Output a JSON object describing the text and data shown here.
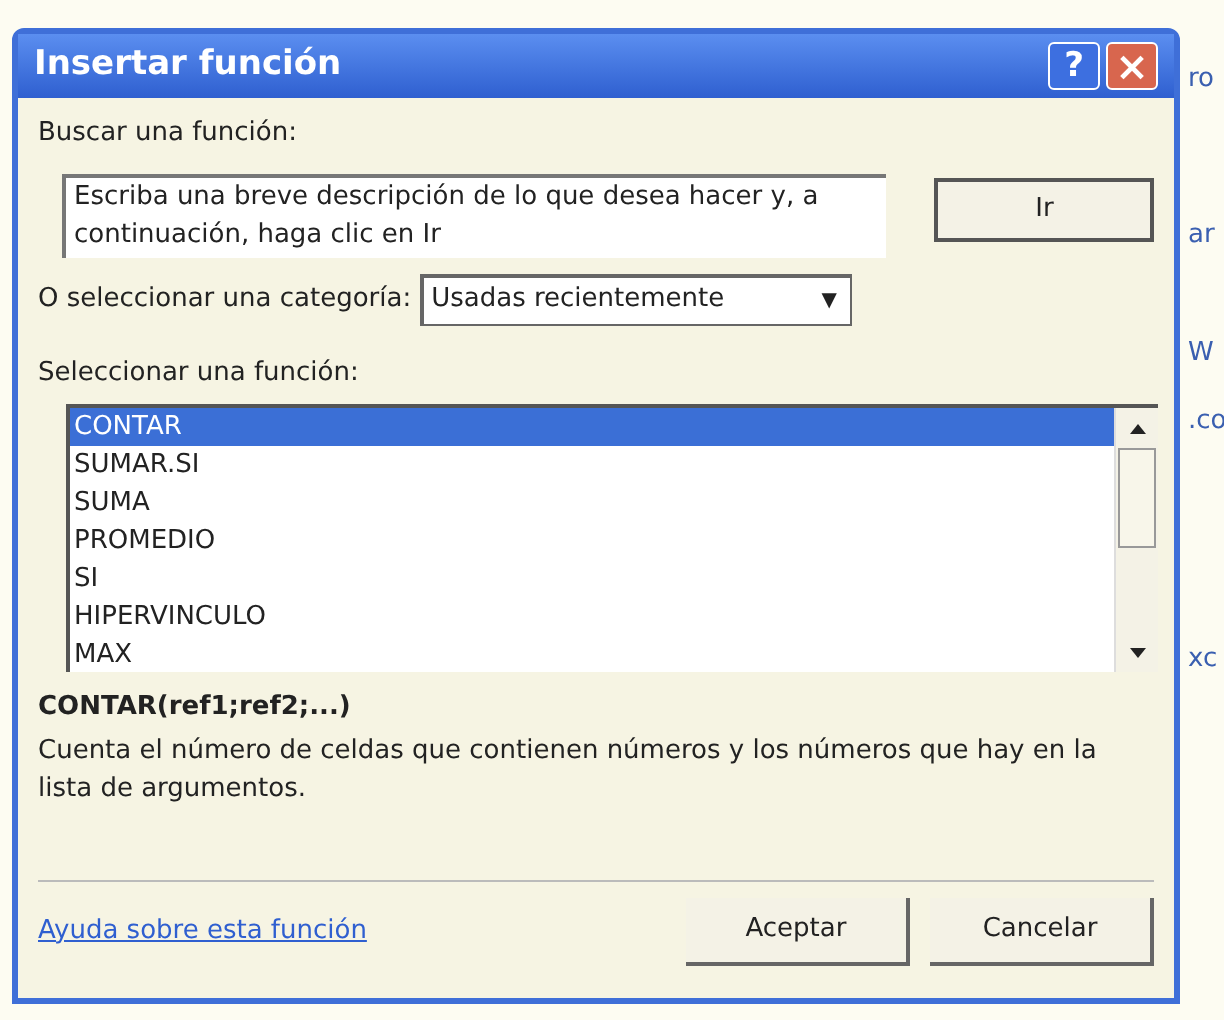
{
  "window": {
    "title": "Insertar función",
    "help_button": "?",
    "close_button": "×"
  },
  "search": {
    "label": "Buscar una función:",
    "placeholder": "Escriba una breve descripción de lo que desea hacer y, a continuación, haga clic en Ir",
    "go_button": "Ir"
  },
  "category": {
    "label": "O seleccionar una categoría:",
    "value": "Usadas recientemente",
    "arrow": "▼"
  },
  "function_list": {
    "label": "Seleccionar una función:",
    "items": [
      {
        "label": "CONTAR",
        "selected": true
      },
      {
        "label": "SUMAR.SI",
        "selected": false
      },
      {
        "label": "SUMA",
        "selected": false
      },
      {
        "label": "PROMEDIO",
        "selected": false
      },
      {
        "label": "SI",
        "selected": false
      },
      {
        "label": "HIPERVINCULO",
        "selected": false
      },
      {
        "label": "MAX",
        "selected": false
      }
    ]
  },
  "signature": "CONTAR(ref1;ref2;...)",
  "description": "Cuenta el número de celdas que contienen números y los números que hay en la lista de argumentos.",
  "help_link": "Ayuda sobre esta función",
  "buttons": [
    "Aceptar",
    "Cancelar"
  ],
  "background_fragments": [
    "ro",
    "ar",
    "W",
    ".co",
    "xc"
  ]
}
